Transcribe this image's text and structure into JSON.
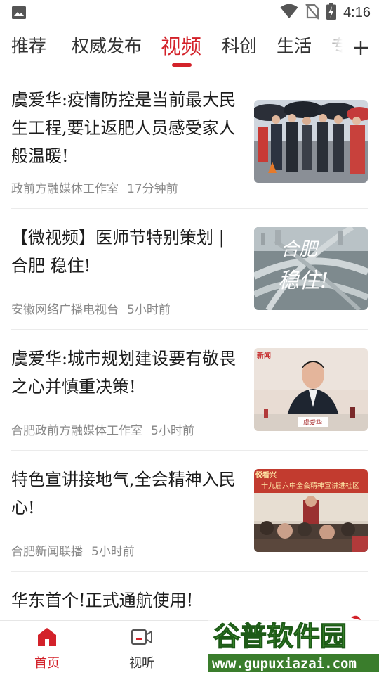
{
  "status_bar": {
    "time": "4:16",
    "icons": [
      "image-icon",
      "wifi-icon",
      "no-sim-icon",
      "battery-charging-icon"
    ]
  },
  "tabs": {
    "items": [
      "推荐",
      "权威发布",
      "视频",
      "科创",
      "生活",
      "专"
    ],
    "active_index": 2,
    "add_icon": "plus-icon"
  },
  "news": [
    {
      "title": "虞爱华:疫情防控是当前最大民生工程,要让返肥人员感受家人般温暖!",
      "source": "政前方融媒体工作室",
      "time": "17分钟前",
      "thumb": "photo-officials-umbrellas"
    },
    {
      "title": "【微视频】医师节特别策划 | 合肥 稳住!",
      "source": "安徽网络广播电视台",
      "time": "5小时前",
      "thumb": "photo-city-interchange",
      "thumb_text": "合肥稳住!"
    },
    {
      "title": "虞爱华:城市规划建设要有敬畏之心并慎重决策!",
      "source": "合肥政前方融媒体工作室",
      "time": "5小时前",
      "thumb": "photo-speaker-at-desk",
      "thumb_text": "虞爱华",
      "thumb_logo": "新闻"
    },
    {
      "title": "特色宣讲接地气,全会精神入民心!",
      "source": "合肥新闻联播",
      "time": "5小时前",
      "thumb": "photo-lecture-community",
      "thumb_text": "十九届六中全会精神宣讲进社区",
      "thumb_logo": "悦看兴"
    },
    {
      "title": "华东首个!正式通航使用!"
    }
  ],
  "bottom_nav": {
    "items": [
      {
        "label": "首页",
        "icon": "home-icon",
        "active": true
      },
      {
        "label": "视听",
        "icon": "video-camera-icon",
        "active": false
      }
    ]
  },
  "watermark": {
    "brand": "谷普软件园",
    "url": "www.gupuxiazai.com"
  },
  "colors": {
    "accent": "#d3222a",
    "text": "#1c1c1c",
    "meta": "#888888",
    "divider": "#ebebeb"
  }
}
